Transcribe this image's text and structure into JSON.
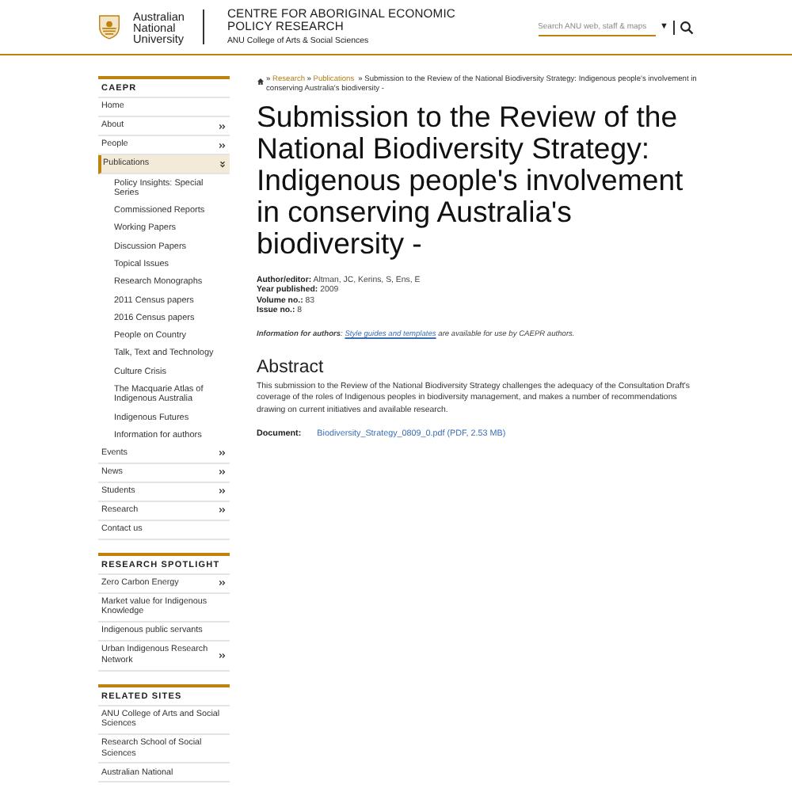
{
  "header": {
    "university": [
      "Australian",
      "National",
      "University"
    ],
    "centre": [
      "CENTRE FOR ABORIGINAL ECONOMIC",
      "POLICY RESEARCH"
    ],
    "college": "ANU College of Arts & Social Sciences",
    "search": {
      "placeholder": "Search ANU web, staff & maps"
    },
    "dropdown": "▼"
  },
  "sidebar": [
    {
      "title": "CAEPR",
      "items": [
        {
          "label": "Home",
          "arrow": false,
          "selected": false
        },
        {
          "label": "About",
          "arrow": true,
          "selected": false
        },
        {
          "label": "People",
          "arrow": true,
          "selected": false
        },
        {
          "label": "Publications",
          "arrow": true,
          "selected": true,
          "expanded": true,
          "children": [
            {
              "label": "Policy Insights: Special Series"
            },
            {
              "label": "Commissioned Reports"
            },
            {
              "label": "Working Papers"
            },
            {
              "label": "Discussion Papers"
            },
            {
              "label": "Topical Issues"
            },
            {
              "label": "Research Monographs"
            },
            {
              "label": "2011 Census papers"
            },
            {
              "label": "2016 Census papers"
            },
            {
              "label": "People on Country"
            },
            {
              "label": "Talk, Text and Technology"
            },
            {
              "label": "Culture Crisis"
            },
            {
              "label": "The Macquarie Atlas of Indigenous Australia"
            },
            {
              "label": "Indigenous Futures"
            },
            {
              "label": "Information for authors"
            }
          ]
        },
        {
          "label": "Events",
          "arrow": true,
          "selected": false
        },
        {
          "label": "News",
          "arrow": true,
          "selected": false
        },
        {
          "label": "Students",
          "arrow": true,
          "selected": false
        },
        {
          "label": "Research",
          "arrow": true,
          "selected": false
        },
        {
          "label": "Contact us",
          "arrow": false,
          "selected": false
        }
      ]
    },
    {
      "title": "RESEARCH SPOTLIGHT",
      "items": [
        {
          "label": "Zero Carbon Energy",
          "arrow": true,
          "selected": false
        },
        {
          "label": "Market value for Indigenous Knowledge",
          "arrow": false,
          "selected": false
        },
        {
          "label": "Indigenous public servants",
          "arrow": false,
          "selected": false
        },
        {
          "label": "Urban Indigenous Research Network",
          "arrow": true,
          "selected": false
        }
      ]
    },
    {
      "title": "RELATED SITES",
      "items": [
        {
          "label": "ANU College of Arts and Social Sciences",
          "arrow": false,
          "selected": false
        },
        {
          "label": "Research School of Social Sciences",
          "arrow": false,
          "selected": false
        },
        {
          "label": "Australian National",
          "arrow": false,
          "selected": false
        }
      ]
    }
  ],
  "breadcrumb": {
    "separator": "»",
    "links": [
      "Research",
      "Publications"
    ],
    "current": "Submission to the Review of the National Biodiversity Strategy: Indigenous people's involvement in conserving Australia's biodiversity -"
  },
  "title": "Submission to the Review of the National Biodiversity Strategy: Indigenous people's involvement in conserving Australia's biodiversity -",
  "meta": [
    {
      "label": "Author/editor:",
      "value": "Altman, JC, Kerins, S, Ens, E"
    },
    {
      "label": "Year published:",
      "value": "2009"
    },
    {
      "label": "Volume no.:",
      "value": "83"
    },
    {
      "label": "Issue no.:",
      "value": "8"
    }
  ],
  "info": {
    "prefix": "**Information for authors**: ",
    "link": "Style guides and templates",
    "suffix": " are available for use by CAEPR authors."
  },
  "abstract": {
    "heading": "Abstract",
    "text": "This submission to the Review of the National Biodiversity Strategy challenges the adequacy of the Consultation Draft's coverage of the roles of Indigenous peoples in biodiversity management, and makes a number of recommendations drawing on current initiatives and available research."
  },
  "document": {
    "label": "Document:",
    "link": "Biodiversity_Strategy_0809_0.pdf (PDF, 2.53 MB)"
  }
}
